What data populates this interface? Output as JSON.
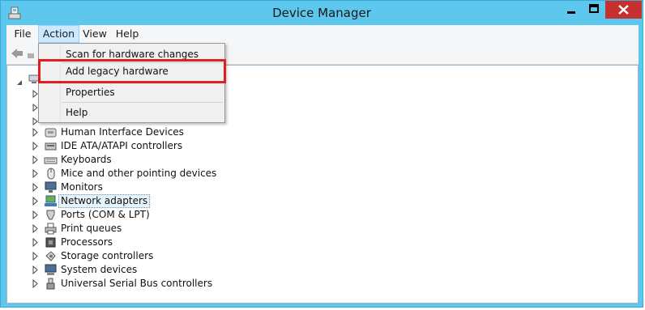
{
  "window": {
    "title": "Device Manager"
  },
  "menubar": {
    "items": [
      "File",
      "Action",
      "View",
      "Help"
    ]
  },
  "action_menu": {
    "items": [
      "Scan for hardware changes",
      "Add legacy hardware",
      "Properties",
      "Help"
    ]
  },
  "tree": {
    "items": [
      "Human Interface Devices",
      "IDE ATA/ATAPI controllers",
      "Keyboards",
      "Mice and other pointing devices",
      "Monitors",
      "Network adapters",
      "Ports (COM & LPT)",
      "Print queues",
      "Processors",
      "Storage controllers",
      "System devices",
      "Universal Serial Bus controllers"
    ],
    "selected": "Network adapters"
  },
  "colors": {
    "titlebar": "#5ec7ed",
    "close_button": "#c7312d",
    "highlight": "#e0201f"
  }
}
